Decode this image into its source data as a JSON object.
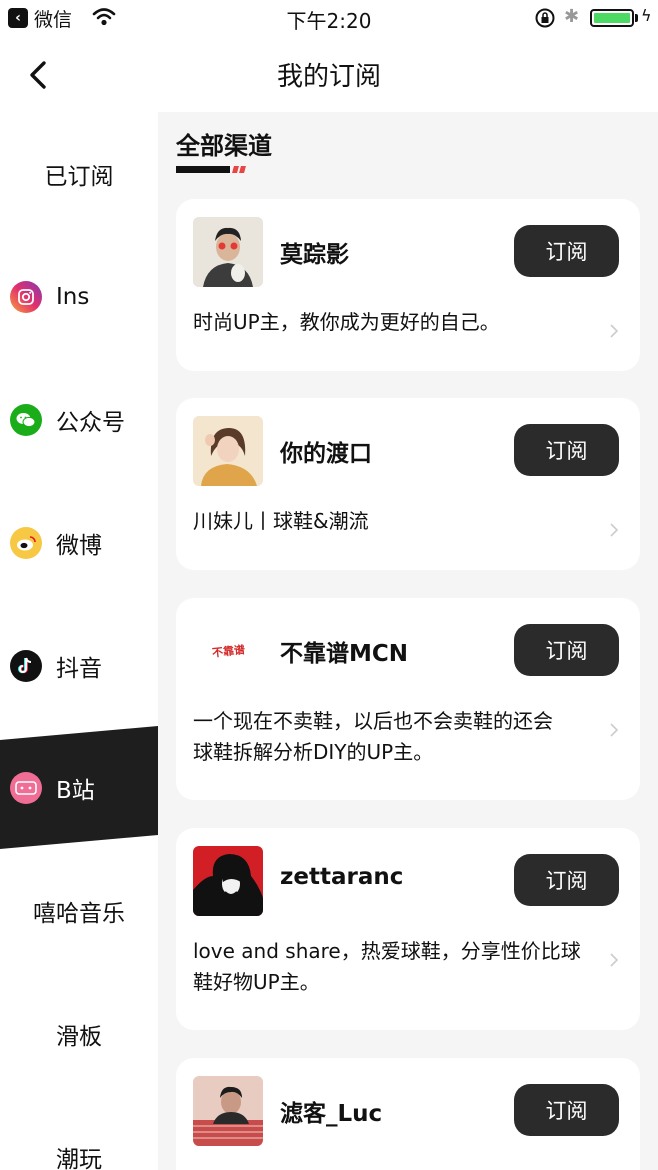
{
  "status_bar": {
    "carrier": "微信",
    "time": "下午2:20"
  },
  "nav": {
    "title": "我的订阅"
  },
  "sidebar": {
    "items": [
      {
        "label": "已订阅",
        "icon": ""
      },
      {
        "label": "Ins",
        "icon": "instagram-icon"
      },
      {
        "label": "公众号",
        "icon": "wechat-icon"
      },
      {
        "label": "微博",
        "icon": "weibo-icon"
      },
      {
        "label": "抖音",
        "icon": "douyin-icon"
      },
      {
        "label": "B站",
        "icon": "bilibili-icon"
      },
      {
        "label": "嘻哈音乐",
        "icon": ""
      },
      {
        "label": "滑板",
        "icon": ""
      },
      {
        "label": "潮玩",
        "icon": ""
      }
    ],
    "active_index": 5
  },
  "main": {
    "section_title": "全部渠道",
    "subscribe_label": "订阅",
    "channels": [
      {
        "name": "莫踪影",
        "description": "时尚UP主，教你成为更好的自己。"
      },
      {
        "name": "你的渡口",
        "description": "川妹儿丨球鞋&潮流"
      },
      {
        "name": "不靠谱MCN",
        "description": "一个现在不卖鞋，以后也不会卖鞋的还会球鞋拆解分析DIY的UP主。",
        "logo_text": "不靠谱"
      },
      {
        "name": "zettaranc",
        "description": "love and share，热爱球鞋，分享性价比球鞋好物UP主。"
      },
      {
        "name": "滤客_Luc",
        "description": ""
      }
    ]
  },
  "colors": {
    "accent_red": "#e84545",
    "button_dark": "#2b2b2b",
    "active_sidebar": "#1e1e1e",
    "battery_green": "#4cd964"
  }
}
